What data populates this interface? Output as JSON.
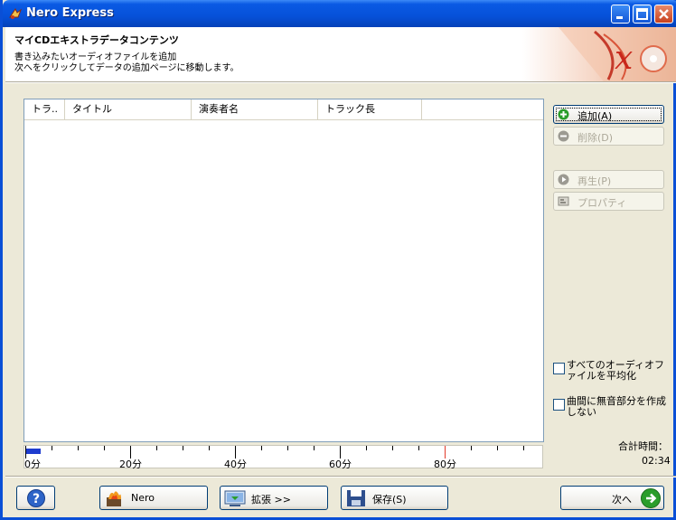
{
  "window": {
    "title": "Nero Express"
  },
  "header": {
    "title": "マイCDエキストラデータコンテンツ",
    "line1": "書き込みたいオーディオファイルを追加",
    "line2": "次へをクリックしてデータの追加ページに移動します。"
  },
  "list": {
    "columns": [
      "トラ..",
      "タイトル",
      "演奏者名",
      "トラック長"
    ]
  },
  "side_buttons": {
    "add": "追加(A)",
    "delete": "削除(D)",
    "play": "再生(P)",
    "properties": "プロパティ"
  },
  "options": {
    "normalize": "すべてのオーディオファイルを平均化",
    "no_pause": "曲間に無音部分を作成しない"
  },
  "ruler": {
    "labels": [
      "0分",
      "20分",
      "40分",
      "60分",
      "80分"
    ],
    "used_fraction": 0.03
  },
  "total": {
    "label": "合計時間：",
    "value": "02:34"
  },
  "footer": {
    "nero": "Nero",
    "expand": "拡張 >>",
    "save": "保存(S)",
    "next": "次へ"
  },
  "colors": {
    "titlebar": "#0651d9",
    "accent_green": "#2b9d2b",
    "ruler_fill": "#1e3ccf"
  }
}
